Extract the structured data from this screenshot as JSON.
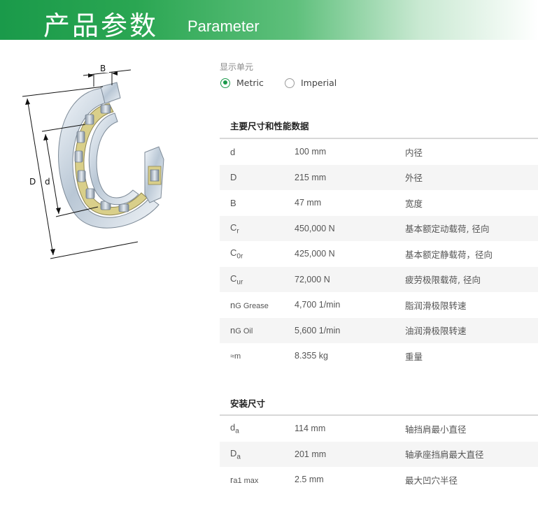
{
  "banner": {
    "title_cn": "产品参数",
    "title_en": "Parameter"
  },
  "illustration": {
    "label_B": "B",
    "label_D": "D",
    "label_d": "d"
  },
  "units": {
    "label": "显示单元",
    "options": [
      {
        "label": "Metric",
        "selected": true
      },
      {
        "label": "Imperial",
        "selected": false
      }
    ]
  },
  "main": {
    "title": "主要尺寸和性能数据",
    "rows": [
      {
        "sym": "d",
        "sub": "",
        "value": "100 mm",
        "desc": "内径"
      },
      {
        "sym": "D",
        "sub": "",
        "value": "215 mm",
        "desc": "外径"
      },
      {
        "sym": "B",
        "sub": "",
        "value": "47 mm",
        "desc": "宽度"
      },
      {
        "sym": "C",
        "sub": "r",
        "value": "450,000 N",
        "desc": "基本额定动载荷, 径向"
      },
      {
        "sym": "C",
        "sub": "0r",
        "value": "425,000 N",
        "desc": "基本额定静载荷，径向"
      },
      {
        "sym": "C",
        "sub": "ur",
        "value": "72,000 N",
        "desc": "疲劳极限载荷, 径向"
      },
      {
        "sym": "n",
        "sub": "G Grease",
        "value": "4,700 1/min",
        "desc": "脂润滑极限转速"
      },
      {
        "sym": "n",
        "sub": "G Oil",
        "value": "5,600 1/min",
        "desc": "油润滑极限转速"
      },
      {
        "sym": "≈m",
        "sub": "",
        "value": "8.355 kg",
        "desc": "重量"
      }
    ]
  },
  "mounting": {
    "title": "安装尺寸",
    "rows": [
      {
        "sym": "d",
        "sub": "a",
        "value": "114 mm",
        "desc": "轴挡肩最小直径"
      },
      {
        "sym": "D",
        "sub": "a",
        "value": "201 mm",
        "desc": "轴承座挡肩最大直径"
      },
      {
        "sym": "r",
        "sub": "a1 max",
        "value": "2.5 mm",
        "desc": "最大凹穴半径"
      }
    ]
  },
  "colors": {
    "brand_green": "#1a9a4a",
    "row_alt": "#f5f5f5",
    "cage_yellow": "#d9cf8a",
    "steel": "#c9d6e2"
  }
}
